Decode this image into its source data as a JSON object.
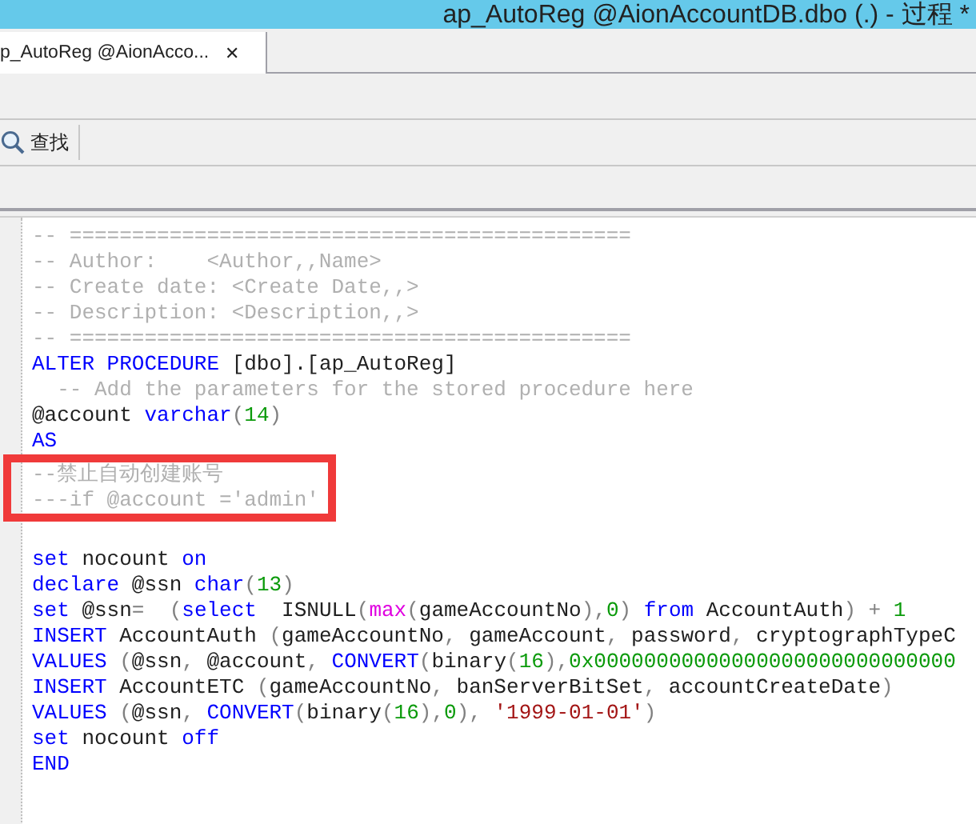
{
  "window": {
    "title": "ap_AutoReg @AionAccountDB.dbo (.) - 过程 *"
  },
  "tabs": [
    {
      "label": "p_AutoReg @AionAcco...",
      "close": "✕",
      "selected": true
    }
  ],
  "toolbar": {
    "find_label": "查找"
  },
  "editor": {
    "lines": [
      {
        "highlighted": false,
        "tokens": [
          {
            "kind": "comment",
            "text": "-- ============================================="
          }
        ]
      },
      {
        "highlighted": false,
        "tokens": [
          {
            "kind": "comment",
            "text": "-- Author:    <Author,,Name>"
          }
        ]
      },
      {
        "highlighted": false,
        "tokens": [
          {
            "kind": "comment",
            "text": "-- Create date: <Create Date,,>"
          }
        ]
      },
      {
        "highlighted": false,
        "tokens": [
          {
            "kind": "comment",
            "text": "-- Description: <Description,,>"
          }
        ]
      },
      {
        "highlighted": false,
        "tokens": [
          {
            "kind": "comment",
            "text": "-- ============================================="
          }
        ]
      },
      {
        "highlighted": false,
        "tokens": [
          {
            "kind": "keyword",
            "text": "ALTER PROCEDURE"
          },
          {
            "kind": "plain",
            "text": " [dbo].[ap_AutoReg]"
          }
        ]
      },
      {
        "highlighted": false,
        "tokens": [
          {
            "kind": "comment",
            "text": "  -- Add the parameters for the stored procedure here"
          }
        ]
      },
      {
        "highlighted": false,
        "tokens": [
          {
            "kind": "plain",
            "text": "@account "
          },
          {
            "kind": "keyword",
            "text": "varchar"
          },
          {
            "kind": "operator",
            "text": "("
          },
          {
            "kind": "number",
            "text": "14"
          },
          {
            "kind": "operator",
            "text": ")"
          }
        ]
      },
      {
        "highlighted": false,
        "tokens": [
          {
            "kind": "keyword",
            "text": "AS"
          }
        ]
      },
      {
        "highlighted": true,
        "tokens": [
          {
            "kind": "comment",
            "text": "--禁止自动创建账号"
          }
        ]
      },
      {
        "highlighted": true,
        "tokens": [
          {
            "kind": "comment",
            "text": "---if @account ='admin'"
          }
        ]
      },
      {
        "highlighted": false
      },
      {
        "highlighted": false,
        "tokens": [
          {
            "kind": "keyword",
            "text": "set"
          },
          {
            "kind": "plain",
            "text": " nocount "
          },
          {
            "kind": "keyword",
            "text": "on"
          }
        ]
      },
      {
        "highlighted": false,
        "tokens": [
          {
            "kind": "keyword",
            "text": "declare"
          },
          {
            "kind": "plain",
            "text": " @ssn "
          },
          {
            "kind": "keyword",
            "text": "char"
          },
          {
            "kind": "operator",
            "text": "("
          },
          {
            "kind": "number",
            "text": "13"
          },
          {
            "kind": "operator",
            "text": ")"
          }
        ]
      },
      {
        "highlighted": false,
        "tokens": [
          {
            "kind": "keyword",
            "text": "set"
          },
          {
            "kind": "plain",
            "text": " @ssn"
          },
          {
            "kind": "operator",
            "text": "=  ("
          },
          {
            "kind": "keyword",
            "text": "select"
          },
          {
            "kind": "plain",
            "text": "  ISNULL"
          },
          {
            "kind": "operator",
            "text": "("
          },
          {
            "kind": "function",
            "text": "max"
          },
          {
            "kind": "operator",
            "text": "("
          },
          {
            "kind": "plain",
            "text": "gameAccountNo"
          },
          {
            "kind": "operator",
            "text": "),"
          },
          {
            "kind": "number",
            "text": "0"
          },
          {
            "kind": "operator",
            "text": ") "
          },
          {
            "kind": "keyword",
            "text": "from"
          },
          {
            "kind": "plain",
            "text": " AccountAuth"
          },
          {
            "kind": "operator",
            "text": ") + "
          },
          {
            "kind": "number",
            "text": "1"
          }
        ]
      },
      {
        "highlighted": false,
        "tokens": [
          {
            "kind": "keyword",
            "text": "INSERT"
          },
          {
            "kind": "plain",
            "text": " AccountAuth "
          },
          {
            "kind": "operator",
            "text": "("
          },
          {
            "kind": "plain",
            "text": "gameAccountNo"
          },
          {
            "kind": "operator",
            "text": ", "
          },
          {
            "kind": "plain",
            "text": "gameAccount"
          },
          {
            "kind": "operator",
            "text": ", "
          },
          {
            "kind": "plain",
            "text": "password"
          },
          {
            "kind": "operator",
            "text": ", "
          },
          {
            "kind": "plain",
            "text": "cryptographTypeC"
          }
        ]
      },
      {
        "highlighted": false,
        "tokens": [
          {
            "kind": "keyword",
            "text": "VALUES"
          },
          {
            "kind": "operator",
            "text": " ("
          },
          {
            "kind": "plain",
            "text": "@ssn"
          },
          {
            "kind": "operator",
            "text": ", "
          },
          {
            "kind": "plain",
            "text": "@account"
          },
          {
            "kind": "operator",
            "text": ", "
          },
          {
            "kind": "keyword",
            "text": "CONVERT"
          },
          {
            "kind": "operator",
            "text": "("
          },
          {
            "kind": "plain",
            "text": "binary"
          },
          {
            "kind": "operator",
            "text": "("
          },
          {
            "kind": "number",
            "text": "16"
          },
          {
            "kind": "operator",
            "text": "),"
          },
          {
            "kind": "number",
            "text": "0x00000000000000000000000000000"
          }
        ]
      },
      {
        "highlighted": false,
        "tokens": [
          {
            "kind": "keyword",
            "text": "INSERT"
          },
          {
            "kind": "plain",
            "text": " AccountETC "
          },
          {
            "kind": "operator",
            "text": "("
          },
          {
            "kind": "plain",
            "text": "gameAccountNo"
          },
          {
            "kind": "operator",
            "text": ", "
          },
          {
            "kind": "plain",
            "text": "banServerBitSet"
          },
          {
            "kind": "operator",
            "text": ", "
          },
          {
            "kind": "plain",
            "text": "accountCreateDate"
          },
          {
            "kind": "operator",
            "text": ")"
          }
        ]
      },
      {
        "highlighted": false,
        "tokens": [
          {
            "kind": "keyword",
            "text": "VALUES"
          },
          {
            "kind": "operator",
            "text": " ("
          },
          {
            "kind": "plain",
            "text": "@ssn"
          },
          {
            "kind": "operator",
            "text": ", "
          },
          {
            "kind": "keyword",
            "text": "CONVERT"
          },
          {
            "kind": "operator",
            "text": "("
          },
          {
            "kind": "plain",
            "text": "binary"
          },
          {
            "kind": "operator",
            "text": "("
          },
          {
            "kind": "number",
            "text": "16"
          },
          {
            "kind": "operator",
            "text": "),"
          },
          {
            "kind": "number",
            "text": "0"
          },
          {
            "kind": "operator",
            "text": "), "
          },
          {
            "kind": "string",
            "text": "'1999-01-01'"
          },
          {
            "kind": "operator",
            "text": ")"
          }
        ]
      },
      {
        "highlighted": false,
        "tokens": [
          {
            "kind": "keyword",
            "text": "set"
          },
          {
            "kind": "plain",
            "text": " nocount "
          },
          {
            "kind": "keyword",
            "text": "off"
          }
        ]
      },
      {
        "highlighted": false,
        "tokens": [
          {
            "kind": "keyword",
            "text": "END"
          }
        ]
      }
    ]
  }
}
